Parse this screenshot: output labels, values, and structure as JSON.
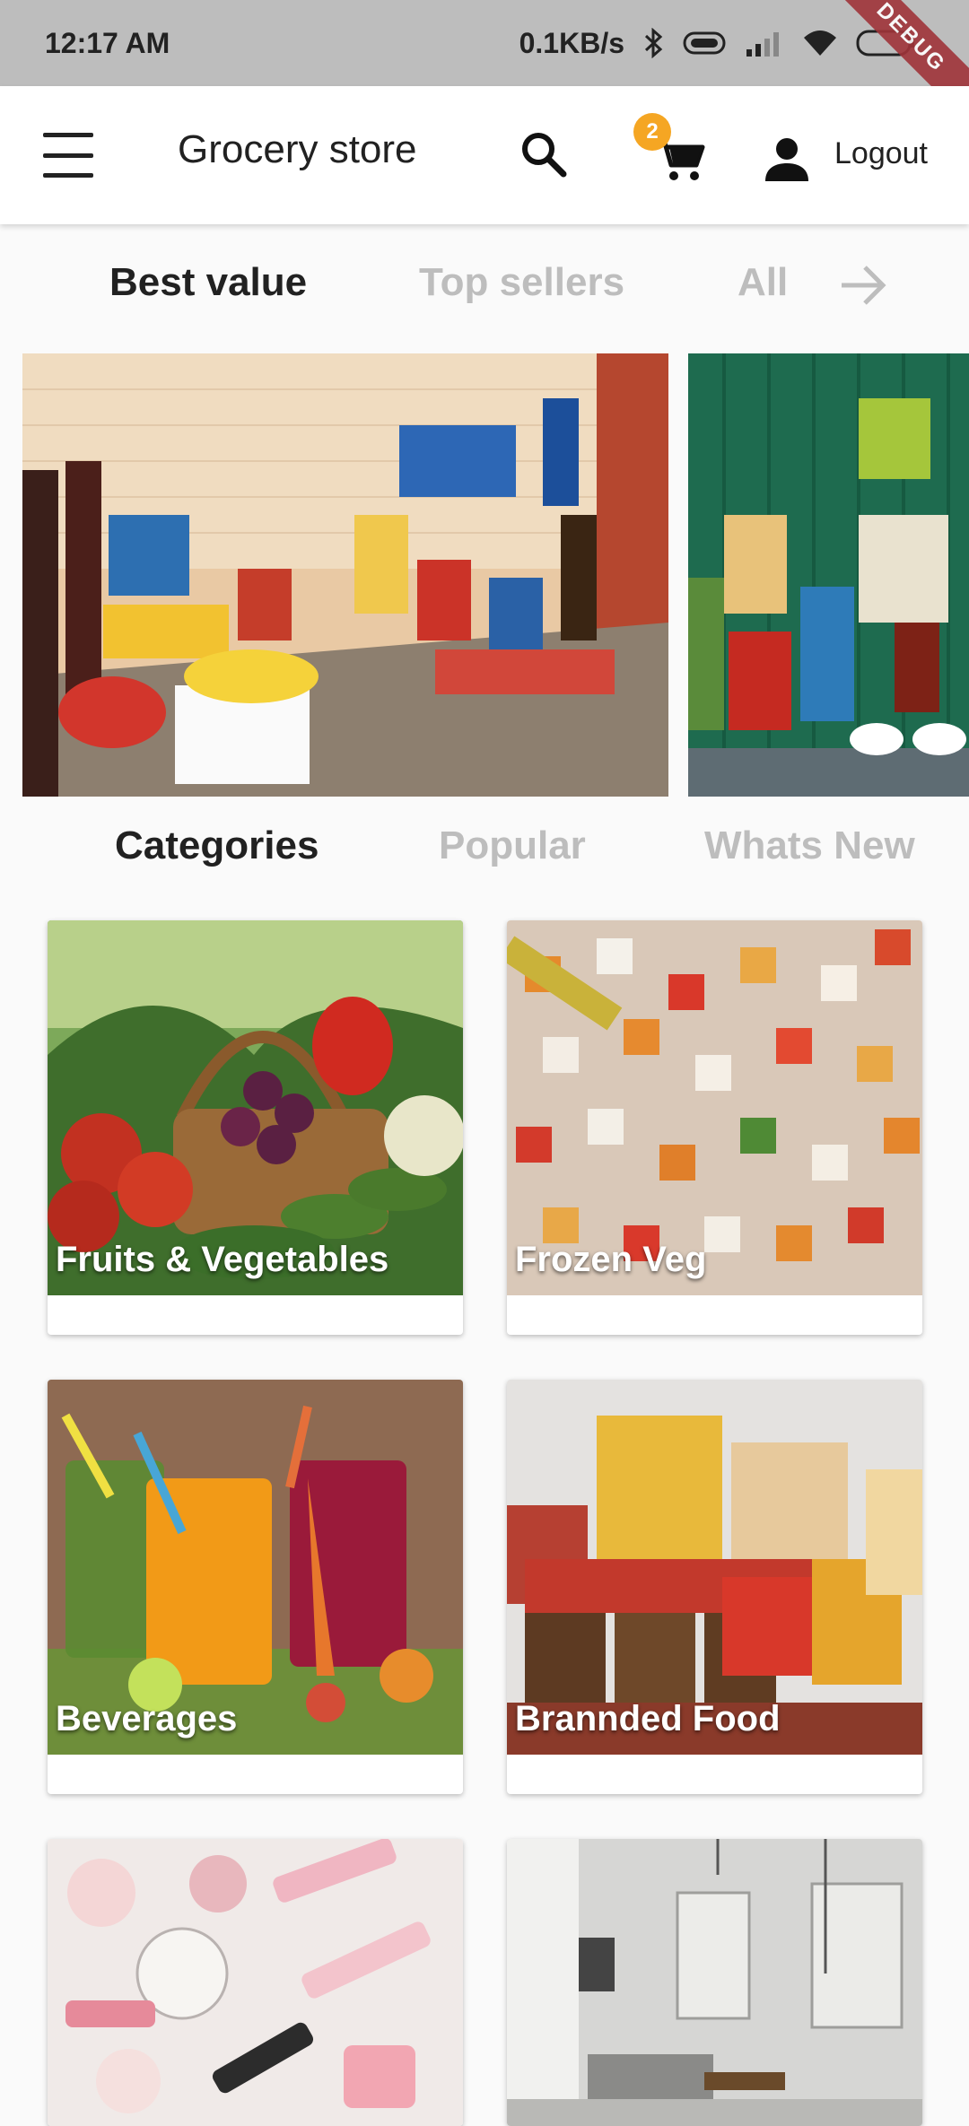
{
  "status": {
    "time": "12:17 AM",
    "speed": "0.1KB/s",
    "battery": "28",
    "debug_banner": "DEBUG"
  },
  "appbar": {
    "title": "Grocery store",
    "cart_count": "2",
    "logout_label": "Logout",
    "icons": [
      "menu-icon",
      "search-icon",
      "cart-icon",
      "user-icon"
    ]
  },
  "top_tabs": {
    "items": [
      "Best value",
      "Top sellers",
      "All"
    ],
    "active": "Best value"
  },
  "category_tabs": {
    "items": [
      "Categories",
      "Popular",
      "Whats New"
    ],
    "active": "Categories"
  },
  "categories": [
    {
      "label": "Fruits & Vegetables"
    },
    {
      "label": "Frozen Veg"
    },
    {
      "label": "Beverages"
    },
    {
      "label": "Brannded Food"
    },
    {
      "label": ""
    },
    {
      "label": ""
    }
  ],
  "colors": {
    "badge": "#f5a623",
    "active_tab": "#212121",
    "inactive_tab": "#bdbdbd"
  }
}
